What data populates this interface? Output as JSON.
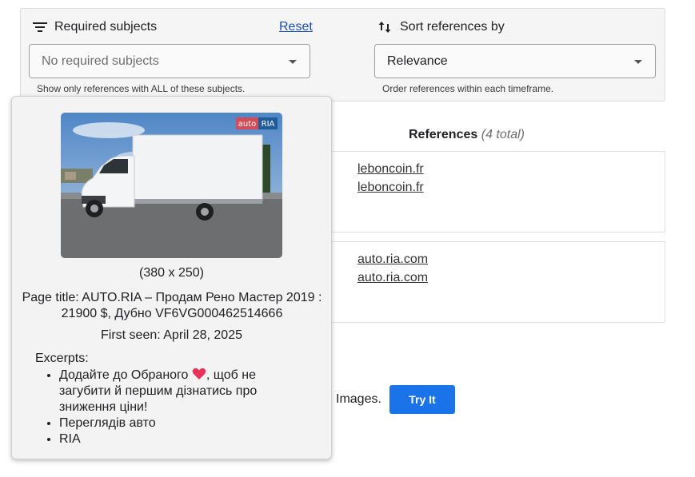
{
  "filters": {
    "required_subjects": {
      "label": "Required subjects",
      "icon": "filter-list-icon",
      "reset_label": "Reset",
      "selected": "No required subjects",
      "helper": "Show only references with ALL of these subjects."
    },
    "sort": {
      "label": "Sort references by",
      "icon": "swap-vert-icon",
      "selected": "Relevance",
      "helper": "Order references within each timeframe."
    }
  },
  "references": {
    "title": "References",
    "count": "(4 total)",
    "cards": [
      {
        "links": [
          "leboncoin.fr",
          "leboncoin.fr"
        ]
      },
      {
        "links": [
          "auto.ria.com",
          "auto.ria.com"
        ]
      }
    ]
  },
  "promo": {
    "text": "Images.",
    "button_label": "Try It"
  },
  "popup": {
    "image_logo": {
      "left": "auto",
      "right": "RIA"
    },
    "dimensions": "(380 x 250)",
    "page_title": "Page title: AUTO.RIA – Продам Рено Мастер 2019 : 21900 $, Дубно VF6VG000462514666",
    "first_seen": "First seen: April 28, 2025",
    "excerpts_label": "Excerpts:",
    "excerpts": [
      {
        "before": "Додайте до Обраного ",
        "after": ", щоб не загубити й першим дізнатись про зниження ціни!",
        "icon": "heart-icon"
      },
      {
        "text": "Переглядів авто"
      },
      {
        "text": "RIA"
      }
    ]
  },
  "colors": {
    "accent": "#1a73e8",
    "link": "#1a4fb8",
    "heart": "#e8335a"
  }
}
